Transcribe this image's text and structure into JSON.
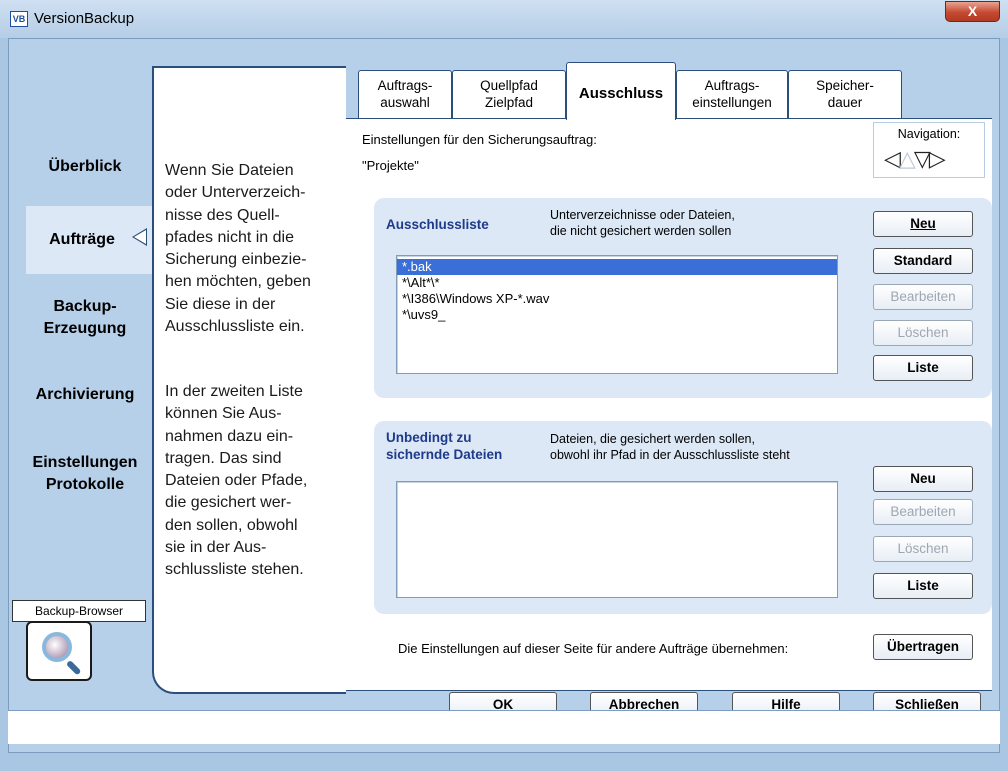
{
  "window": {
    "title": "VersionBackup",
    "icon_text": "VB",
    "close_glyph": "X"
  },
  "nav": {
    "items": [
      {
        "label": "Überblick"
      },
      {
        "label": "Aufträge"
      },
      {
        "label": "Backup-\nErzeugung"
      },
      {
        "label": "Archivierung"
      },
      {
        "label": "Einstellungen\nProtokolle"
      }
    ],
    "active_item": "Aufträge",
    "backup_browser_label": "Backup-Browser"
  },
  "help": {
    "paragraph1": "Wenn Sie Dateien\noder Unterverzeich-\nnisse des Quell-\npfades nicht in die\nSicherung einbezie-\nhen möchten, geben\nSie diese in der\nAusschlussliste ein.",
    "paragraph2": "In der zweiten Liste\nkönnen Sie Aus-\nnahmen dazu ein-\ntragen. Das sind\nDateien oder Pfade,\ndie gesichert wer-\nden sollen, obwohl\nsie in der Aus-\nschlussliste stehen."
  },
  "tabs": [
    {
      "label": "Auftrags-\nauswahl",
      "active": false
    },
    {
      "label": "Quellpfad\nZielpfad",
      "active": false
    },
    {
      "label": "Ausschluss",
      "active": true
    },
    {
      "label": "Auftrags-\neinstellungen",
      "active": false
    },
    {
      "label": "Speicher-\ndauer",
      "active": false
    }
  ],
  "header": {
    "settings_label": "Einstellungen für den Sicherungsauftrag:",
    "job_name": "\"Projekte\"",
    "navigation_label": "Navigation:",
    "nav_arrows": [
      "◁",
      "△",
      "▽",
      "▷"
    ]
  },
  "exclusion": {
    "title": "Ausschlussliste",
    "description": "Unterverzeichnisse oder Dateien,\ndie nicht gesichert werden sollen",
    "items": [
      "*.bak",
      "*\\Alt*\\*",
      "*\\I386\\Windows XP-*.wav",
      "*\\uvs9_"
    ],
    "selected_index": 0,
    "buttons": {
      "new": "Neu",
      "standard": "Standard",
      "edit": "Bearbeiten",
      "delete": "Löschen",
      "list": "Liste"
    }
  },
  "inclusion": {
    "title": "Unbedingt zu\nsichernde Dateien",
    "description": "Dateien, die gesichert werden sollen,\nobwohl ihr Pfad in der Ausschlussliste steht",
    "items": [],
    "buttons": {
      "new": "Neu",
      "edit": "Bearbeiten",
      "delete": "Löschen",
      "list": "Liste"
    }
  },
  "transfer": {
    "label": "Die Einstellungen auf dieser Seite für andere Aufträge übernehmen:",
    "button": "Übertragen"
  },
  "footer": {
    "ok": "OK",
    "cancel": "Abbrechen",
    "help": "Hilfe",
    "close": "Schließen"
  },
  "colors": {
    "frame": "#b6d0ea",
    "panel_border": "#2b4e7a",
    "group_bg": "#dce8f6",
    "group_title": "#1e3a8a",
    "selection": "#3a6fd8"
  }
}
